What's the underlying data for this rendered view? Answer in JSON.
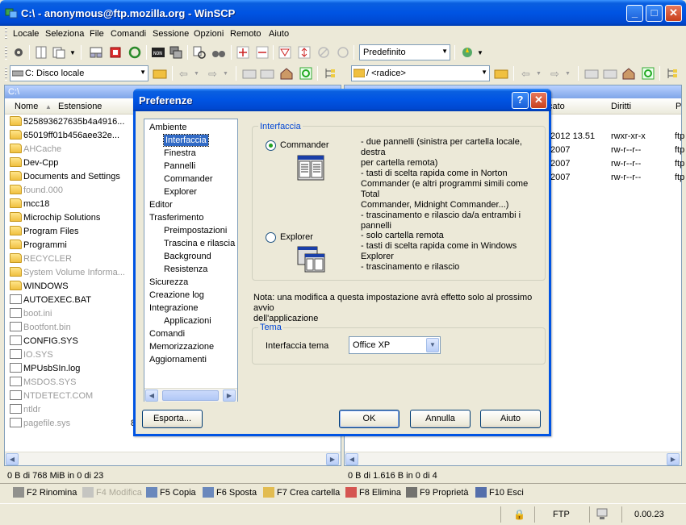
{
  "window": {
    "title": "C:\\ - anonymous@ftp.mozilla.org - WinSCP",
    "minimize": "_",
    "maximize": "□",
    "close": "✕"
  },
  "menu": [
    "Locale",
    "Seleziona",
    "File",
    "Comandi",
    "Sessione",
    "Opzioni",
    "Remoto",
    "Aiuto"
  ],
  "toolbar": {
    "preset_combo": "Predefinito"
  },
  "left_drive": {
    "value": "C: Disco locale"
  },
  "right_path": {
    "value": "/ <radice>"
  },
  "left_pane": {
    "path": "C:\\",
    "columns": [
      "Nome",
      "Estensione"
    ],
    "rows": [
      {
        "name": "525893627635b4a4916...",
        "type": "folder",
        "hidden": false
      },
      {
        "name": "65019ff01b456aee32e...",
        "type": "folder",
        "hidden": false
      },
      {
        "name": "AHCache",
        "type": "folder",
        "hidden": true
      },
      {
        "name": "Dev-Cpp",
        "type": "folder",
        "hidden": false
      },
      {
        "name": "Documents and Settings",
        "type": "folder",
        "hidden": false
      },
      {
        "name": "found.000",
        "type": "folder",
        "hidden": true
      },
      {
        "name": "mcc18",
        "type": "folder",
        "hidden": false
      },
      {
        "name": "Microchip Solutions",
        "type": "folder",
        "hidden": false
      },
      {
        "name": "Program Files",
        "type": "folder",
        "hidden": false
      },
      {
        "name": "Programmi",
        "type": "folder",
        "hidden": false
      },
      {
        "name": "RECYCLER",
        "type": "folder",
        "hidden": true
      },
      {
        "name": "System Volume Informa...",
        "type": "folder",
        "hidden": true
      },
      {
        "name": "WINDOWS",
        "type": "folder",
        "hidden": false
      },
      {
        "name": "AUTOEXEC.BAT",
        "type": "file",
        "hidden": false
      },
      {
        "name": "boot.ini",
        "type": "file",
        "hidden": true
      },
      {
        "name": "Bootfont.bin",
        "type": "file",
        "hidden": true
      },
      {
        "name": "CONFIG.SYS",
        "type": "file",
        "hidden": false
      },
      {
        "name": "IO.SYS",
        "type": "file",
        "hidden": true
      },
      {
        "name": "MPUsbSIn.log",
        "type": "file",
        "hidden": false
      },
      {
        "name": "MSDOS.SYS",
        "type": "file",
        "hidden": true
      },
      {
        "name": "NTDETECT.COM",
        "type": "file",
        "hidden": true
      },
      {
        "name": "ntldr",
        "type": "file",
        "hidden": true
      },
      {
        "name": "pagefile.sys",
        "type": "file",
        "hidden": true
      }
    ],
    "partial_size": "8",
    "status": "0 B di 768 MiB in 0 di 23"
  },
  "right_pane": {
    "columns": [
      "cato",
      "Diritti",
      "P"
    ],
    "rows": [
      {
        "date": "/2012 13.51",
        "rights": "rwxr-xr-x",
        "owner": "ftp"
      },
      {
        "date": "/2007",
        "rights": "rw-r--r--",
        "owner": "ftp"
      },
      {
        "date": "/2007",
        "rights": "rw-r--r--",
        "owner": "ftp"
      },
      {
        "date": "/2007",
        "rights": "rw-r--r--",
        "owner": "ftp"
      }
    ],
    "status": "0 B di 1.616 B in 0 di 4"
  },
  "fkeys": [
    {
      "label": "F2 Rinomina",
      "disabled": false
    },
    {
      "label": "F4 Modifica",
      "disabled": true
    },
    {
      "label": "F5 Copia",
      "disabled": false
    },
    {
      "label": "F6 Sposta",
      "disabled": false
    },
    {
      "label": "F7 Crea cartella",
      "disabled": false
    },
    {
      "label": "F8 Elimina",
      "disabled": false
    },
    {
      "label": "F9 Proprietà",
      "disabled": false
    },
    {
      "label": "F10 Esci",
      "disabled": false
    }
  ],
  "statusbar": {
    "protocol": "FTP",
    "time": "0.00.23"
  },
  "dialog": {
    "title": "Preferenze",
    "help_btn": "?",
    "close_btn": "✕",
    "tree": [
      {
        "label": "Ambiente",
        "level": 0
      },
      {
        "label": "Interfaccia",
        "level": 1,
        "selected": true
      },
      {
        "label": "Finestra",
        "level": 1
      },
      {
        "label": "Pannelli",
        "level": 1
      },
      {
        "label": "Commander",
        "level": 1
      },
      {
        "label": "Explorer",
        "level": 1
      },
      {
        "label": "Editor",
        "level": 0
      },
      {
        "label": "Trasferimento",
        "level": 0
      },
      {
        "label": "Preimpostazioni",
        "level": 1
      },
      {
        "label": "Trascina e rilascia",
        "level": 1
      },
      {
        "label": "Background",
        "level": 1
      },
      {
        "label": "Resistenza",
        "level": 1
      },
      {
        "label": "Sicurezza",
        "level": 0
      },
      {
        "label": "Creazione log",
        "level": 0
      },
      {
        "label": "Integrazione",
        "level": 0
      },
      {
        "label": "Applicazioni",
        "level": 1
      },
      {
        "label": "Comandi",
        "level": 0
      },
      {
        "label": "Memorizzazione",
        "level": 0
      },
      {
        "label": "Aggiornamenti",
        "level": 0
      }
    ],
    "interface_group": "Interfaccia",
    "commander_label": "Commander",
    "commander_desc": [
      "- due pannelli (sinistra per cartella locale, destra",
      "per cartella remota)",
      "- tasti di scelta rapida come in Norton",
      "Commander (e altri programmi simili come Total",
      "Commander, Midnight Commander...)",
      "- trascinamento e rilascio da/a entrambi i",
      "pannelli"
    ],
    "explorer_label": "Explorer",
    "explorer_desc": [
      "- solo cartella remota",
      "- tasti di scelta rapida come in Windows",
      "Explorer",
      "- trascinamento e rilascio"
    ],
    "selected_interface": "Commander",
    "note": [
      "Nota: una modifica a questa impostazione avrà effetto solo al prossimo avvio",
      "dell'applicazione"
    ],
    "theme_group": "Tema",
    "theme_label": "Interfaccia tema",
    "theme_value": "Office XP",
    "export_btn": "Esporta...",
    "ok_btn": "OK",
    "cancel_btn": "Annulla",
    "help_button": "Aiuto"
  }
}
